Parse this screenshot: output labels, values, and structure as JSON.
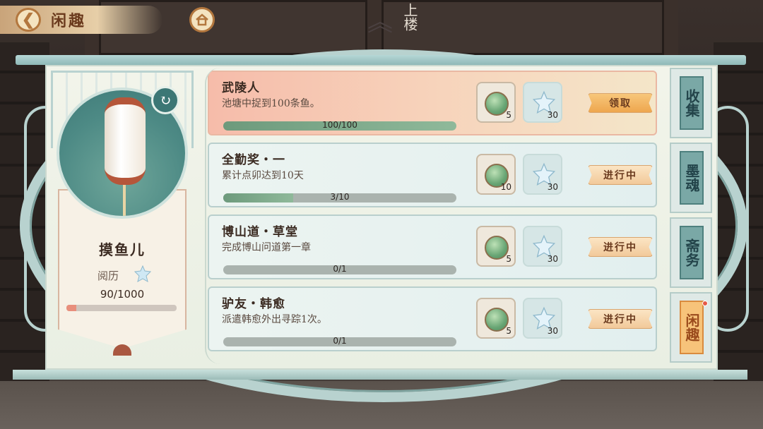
{
  "header": {
    "title": "闲趣",
    "back_icon": "back-arrow-icon",
    "home_icon": "home-icon"
  },
  "background": {
    "stairs_sign": "上楼"
  },
  "profile": {
    "name": "摸鱼儿",
    "exp_label": "阅历",
    "exp_value": "90/1000",
    "exp_fraction": 0.09
  },
  "tasks": [
    {
      "title": "武陵人",
      "desc": "池塘中捉到100条鱼。",
      "progress": "100/100",
      "fraction": 1.0,
      "jade": "5",
      "star": "30",
      "button": "领取",
      "state": "claimable"
    },
    {
      "title": "全勤奖・一",
      "desc": "累计点卯达到10天",
      "progress": "3/10",
      "fraction": 0.3,
      "jade": "10",
      "star": "30",
      "button": "进行中",
      "state": "in_progress"
    },
    {
      "title": "博山道・草堂",
      "desc": "完成博山问道第一章",
      "progress": "0/1",
      "fraction": 0.0,
      "jade": "5",
      "star": "30",
      "button": "进行中",
      "state": "in_progress"
    },
    {
      "title": "驴友・韩愈",
      "desc": "派遣韩愈外出寻踪1次。",
      "progress": "0/1",
      "fraction": 0.0,
      "jade": "5",
      "star": "30",
      "button": "进行中",
      "state": "in_progress"
    }
  ],
  "tabs": [
    {
      "label": "收集",
      "active": false
    },
    {
      "label": "墨魂",
      "active": false
    },
    {
      "label": "斋务",
      "active": false
    },
    {
      "label": "闲趣",
      "active": true
    }
  ],
  "colors": {
    "accent": "#f7c37a",
    "teal": "#7aa8a6",
    "claim_bg": "#f6bcaa"
  }
}
